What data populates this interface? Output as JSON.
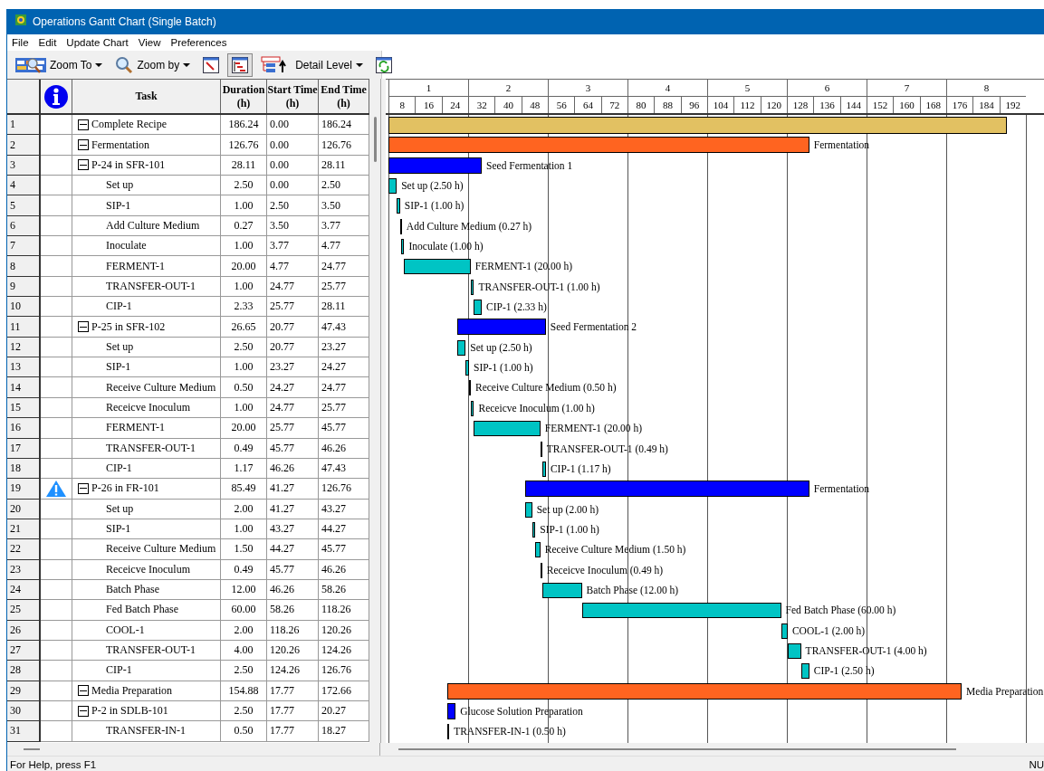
{
  "window": {
    "title": "Operations Gantt Chart (Single Batch)"
  },
  "menu": [
    "File",
    "Edit",
    "Update Chart",
    "View",
    "Preferences"
  ],
  "toolbar": [
    {
      "kind": "dropdown",
      "label": "Zoom To",
      "selected": false
    },
    {
      "kind": "dropdown",
      "label": "Zoom by",
      "selected": false
    },
    {
      "kind": "icon",
      "selected": false
    },
    {
      "kind": "icon",
      "selected": true
    },
    {
      "kind": "dropdown",
      "label": "Detail Level",
      "selected": false
    },
    {
      "kind": "icon",
      "selected": false
    }
  ],
  "table": {
    "columns": [
      "Task",
      "Duration\n(h)",
      "Start Time\n(h)",
      "End Time\n(h)"
    ],
    "rows": [
      {
        "row": "1",
        "task": "Complete Recipe",
        "duration": "186.24",
        "start": "0.00",
        "end": "186.24",
        "kind": "summary",
        "expanded": true,
        "alert": false,
        "children": [
          {
            "row": "2",
            "task": "Fermentation",
            "duration": "126.76",
            "start": "0.00",
            "end": "126.76",
            "kind": "section",
            "expanded": true,
            "alert": false,
            "bar_label": "Fermentation",
            "children": [
              {
                "row": "3",
                "task": "P-24 in SFR-101",
                "duration": "28.11",
                "start": "0.00",
                "end": "28.11",
                "kind": "procedure",
                "expanded": true,
                "alert": false,
                "bar_label": "Seed Fermentation 1",
                "children": [
                  {
                    "row": "4",
                    "task": "Set up",
                    "duration": "2.50",
                    "start": "0.00",
                    "end": "2.50",
                    "kind": "operation",
                    "alert": false,
                    "bar_label": "Set up (2.50 h)"
                  },
                  {
                    "row": "5",
                    "task": "SIP-1",
                    "duration": "1.00",
                    "start": "2.50",
                    "end": "3.50",
                    "kind": "operation",
                    "alert": false,
                    "bar_label": "SIP-1 (1.00 h)"
                  },
                  {
                    "row": "6",
                    "task": "Add Culture Medium",
                    "duration": "0.27",
                    "start": "3.50",
                    "end": "3.77",
                    "kind": "operation",
                    "alert": false,
                    "bar_label": "Add Culture Medium (0.27 h)"
                  },
                  {
                    "row": "7",
                    "task": "Inoculate",
                    "duration": "1.00",
                    "start": "3.77",
                    "end": "4.77",
                    "kind": "operation",
                    "alert": false,
                    "bar_label": "Inoculate (1.00 h)"
                  },
                  {
                    "row": "8",
                    "task": "FERMENT-1",
                    "duration": "20.00",
                    "start": "4.77",
                    "end": "24.77",
                    "kind": "operation",
                    "alert": false,
                    "bar_label": "FERMENT-1 (20.00 h)"
                  },
                  {
                    "row": "9",
                    "task": "TRANSFER-OUT-1",
                    "duration": "1.00",
                    "start": "24.77",
                    "end": "25.77",
                    "kind": "operation",
                    "alert": false,
                    "bar_label": "TRANSFER-OUT-1 (1.00 h)"
                  },
                  {
                    "row": "10",
                    "task": "CIP-1",
                    "duration": "2.33",
                    "start": "25.77",
                    "end": "28.11",
                    "kind": "operation",
                    "alert": false,
                    "bar_label": "CIP-1 (2.33 h)"
                  }
                ]
              },
              {
                "row": "11",
                "task": "P-25 in SFR-102",
                "duration": "26.65",
                "start": "20.77",
                "end": "47.43",
                "kind": "procedure",
                "expanded": true,
                "alert": false,
                "bar_label": "Seed Fermentation 2",
                "children": [
                  {
                    "row": "12",
                    "task": "Set up",
                    "duration": "2.50",
                    "start": "20.77",
                    "end": "23.27",
                    "kind": "operation",
                    "alert": false,
                    "bar_label": "Set up (2.50 h)"
                  },
                  {
                    "row": "13",
                    "task": "SIP-1",
                    "duration": "1.00",
                    "start": "23.27",
                    "end": "24.27",
                    "kind": "operation",
                    "alert": false,
                    "bar_label": "SIP-1 (1.00 h)"
                  },
                  {
                    "row": "14",
                    "task": "Receive Culture Medium",
                    "duration": "0.50",
                    "start": "24.27",
                    "end": "24.77",
                    "kind": "operation",
                    "alert": false,
                    "bar_label": "Receive Culture Medium (0.50 h)"
                  },
                  {
                    "row": "15",
                    "task": "Receicve Inoculum",
                    "duration": "1.00",
                    "start": "24.77",
                    "end": "25.77",
                    "kind": "operation",
                    "alert": false,
                    "bar_label": "Receicve Inoculum (1.00 h)"
                  },
                  {
                    "row": "16",
                    "task": "FERMENT-1",
                    "duration": "20.00",
                    "start": "25.77",
                    "end": "45.77",
                    "kind": "operation",
                    "alert": false,
                    "bar_label": "FERMENT-1 (20.00 h)"
                  },
                  {
                    "row": "17",
                    "task": "TRANSFER-OUT-1",
                    "duration": "0.49",
                    "start": "45.77",
                    "end": "46.26",
                    "kind": "operation",
                    "alert": false,
                    "bar_label": "TRANSFER-OUT-1 (0.49 h)"
                  },
                  {
                    "row": "18",
                    "task": "CIP-1",
                    "duration": "1.17",
                    "start": "46.26",
                    "end": "47.43",
                    "kind": "operation",
                    "alert": false,
                    "bar_label": "CIP-1 (1.17 h)"
                  }
                ]
              },
              {
                "row": "19",
                "task": "P-26 in FR-101",
                "duration": "85.49",
                "start": "41.27",
                "end": "126.76",
                "kind": "procedure",
                "expanded": true,
                "alert": true,
                "bar_label": "Fermentation",
                "children": [
                  {
                    "row": "20",
                    "task": "Set up",
                    "duration": "2.00",
                    "start": "41.27",
                    "end": "43.27",
                    "kind": "operation",
                    "alert": false,
                    "bar_label": "Set up (2.00 h)"
                  },
                  {
                    "row": "21",
                    "task": "SIP-1",
                    "duration": "1.00",
                    "start": "43.27",
                    "end": "44.27",
                    "kind": "operation",
                    "alert": false,
                    "bar_label": "SIP-1 (1.00 h)"
                  },
                  {
                    "row": "22",
                    "task": "Receive Culture Medium",
                    "duration": "1.50",
                    "start": "44.27",
                    "end": "45.77",
                    "kind": "operation",
                    "alert": false,
                    "bar_label": "Receive Culture Medium (1.50 h)"
                  },
                  {
                    "row": "23",
                    "task": "Receicve Inoculum",
                    "duration": "0.49",
                    "start": "45.77",
                    "end": "46.26",
                    "kind": "operation",
                    "alert": false,
                    "bar_label": "Receicve Inoculum (0.49 h)"
                  },
                  {
                    "row": "24",
                    "task": "Batch Phase",
                    "duration": "12.00",
                    "start": "46.26",
                    "end": "58.26",
                    "kind": "operation",
                    "alert": false,
                    "bar_label": "Batch Phase (12.00 h)"
                  },
                  {
                    "row": "25",
                    "task": "Fed Batch Phase",
                    "duration": "60.00",
                    "start": "58.26",
                    "end": "118.26",
                    "kind": "operation",
                    "alert": false,
                    "bar_label": "Fed Batch Phase (60.00 h)"
                  },
                  {
                    "row": "26",
                    "task": "COOL-1",
                    "duration": "2.00",
                    "start": "118.26",
                    "end": "120.26",
                    "kind": "operation",
                    "alert": false,
                    "bar_label": "COOL-1 (2.00 h)"
                  },
                  {
                    "row": "27",
                    "task": "TRANSFER-OUT-1",
                    "duration": "4.00",
                    "start": "120.26",
                    "end": "124.26",
                    "kind": "operation",
                    "alert": false,
                    "bar_label": "TRANSFER-OUT-1 (4.00 h)"
                  },
                  {
                    "row": "28",
                    "task": "CIP-1",
                    "duration": "2.50",
                    "start": "124.26",
                    "end": "126.76",
                    "kind": "operation",
                    "alert": false,
                    "bar_label": "CIP-1 (2.50 h)"
                  }
                ]
              }
            ]
          },
          {
            "row": "29",
            "task": "Media Preparation",
            "duration": "154.88",
            "start": "17.77",
            "end": "172.66",
            "kind": "section",
            "expanded": true,
            "alert": false,
            "bar_label": "Media Preparation",
            "children": [
              {
                "row": "30",
                "task": "P-2 in SDLB-101",
                "duration": "2.50",
                "start": "17.77",
                "end": "20.27",
                "kind": "procedure",
                "expanded": true,
                "alert": false,
                "bar_label": "Glucose Solution Preparation",
                "children": [
                  {
                    "row": "31",
                    "task": "TRANSFER-IN-1",
                    "duration": "0.50",
                    "start": "17.77",
                    "end": "18.27",
                    "kind": "operation",
                    "alert": false,
                    "bar_label": "TRANSFER-IN-1 (0.50 h)"
                  }
                ]
              }
            ]
          }
        ]
      }
    ]
  },
  "chart": {
    "days": [
      "1",
      "2",
      "3",
      "4",
      "5",
      "6",
      "7",
      "8"
    ],
    "hour_ticks": [
      "8",
      "16",
      "24",
      "32",
      "40",
      "48",
      "56",
      "64",
      "72",
      "80",
      "88",
      "96",
      "104",
      "112",
      "120",
      "128",
      "136",
      "144",
      "152",
      "160",
      "168",
      "176",
      "184",
      "192"
    ]
  },
  "status_bar": {
    "text": "For Help, press F1",
    "indicator": "NU"
  }
}
